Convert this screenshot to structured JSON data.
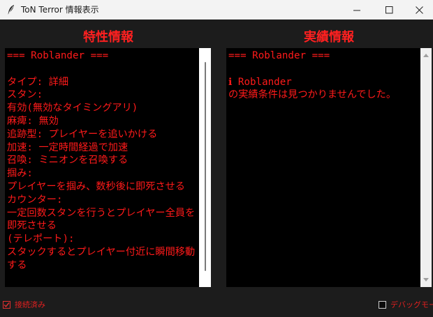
{
  "window": {
    "title": "ToN Terror 情報表示",
    "icon": "feather-icon"
  },
  "colors": {
    "accent_red": "#ff2020",
    "background": "#1c1c1c",
    "panel": "#000000"
  },
  "traits_panel": {
    "heading": "特性情報",
    "text": "=== Roblander ===\n\nタイプ: 詳細\nスタン:\n有効(無効なタイミングアリ)\n麻痺: 無効\n追跡型: プレイヤーを追いかける\n加速: 一定時間経過で加速\n召喚: ミニオンを召喚する\n掴み:\nプレイヤーを掴み、数秒後に即死させる\nカウンター:\n一定回数スタンを行うとプレイヤー全員を即死させる\n(テレポート):\nスタックするとプレイヤー付近に瞬間移動する"
  },
  "achievements_panel": {
    "heading": "実績情報",
    "text": "=== Roblander ===\n\nℹ Roblander\nの実績条件は見つかりませんでした。"
  },
  "status_bar": {
    "connected_label": "接続済み",
    "connected_checked": true,
    "debug_label": "デバッグモード",
    "debug_checked": false
  }
}
